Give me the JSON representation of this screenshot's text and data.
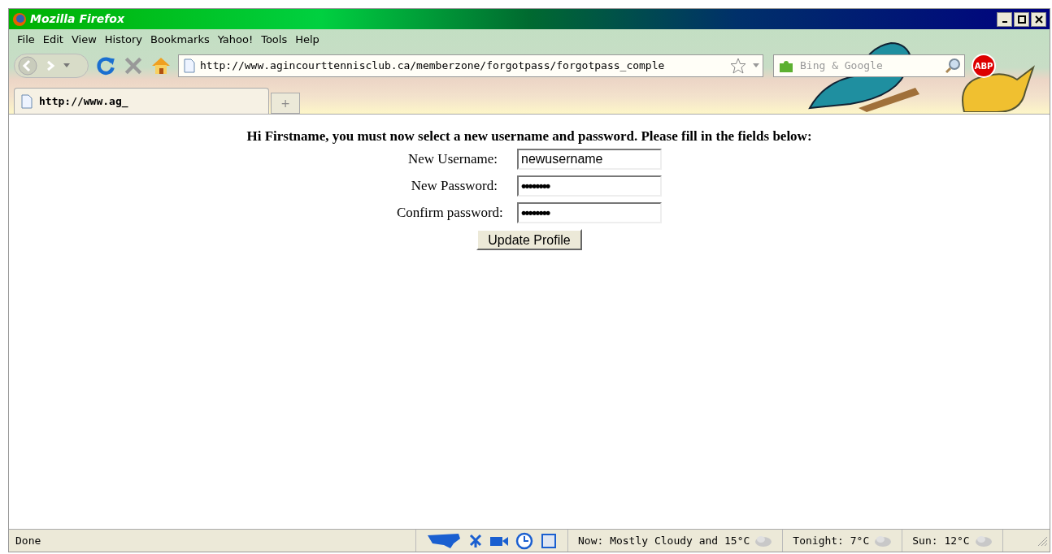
{
  "window": {
    "title": "Mozilla Firefox"
  },
  "menu": [
    "File",
    "Edit",
    "View",
    "History",
    "Bookmarks",
    "Yahoo!",
    "Tools",
    "Help"
  ],
  "address_bar": {
    "value": "http://www.agincourttennisclub.ca/memberzone/forgotpass/forgotpass_comple"
  },
  "search": {
    "placeholder": "Bing & Google"
  },
  "addon_badge": "ABP",
  "tabs": [
    {
      "label": "http://www.ag_",
      "selected": true
    }
  ],
  "new_tab": "+",
  "page": {
    "heading": "Hi Firstname, you must now select a new username and password. Please fill in the fields below:",
    "fields": [
      {
        "label": "New Username:",
        "value": "newusername",
        "kind": "text"
      },
      {
        "label": "New Password:",
        "value": "••••••••",
        "kind": "password"
      },
      {
        "label": "Confirm password:",
        "value": "••••••••",
        "kind": "password"
      }
    ],
    "button": "Update Profile"
  },
  "status_bar": {
    "text": "Done",
    "weather": [
      "Now: Mostly Cloudy and 15°C",
      "Tonight: 7°C",
      "Sun: 12°C"
    ]
  }
}
